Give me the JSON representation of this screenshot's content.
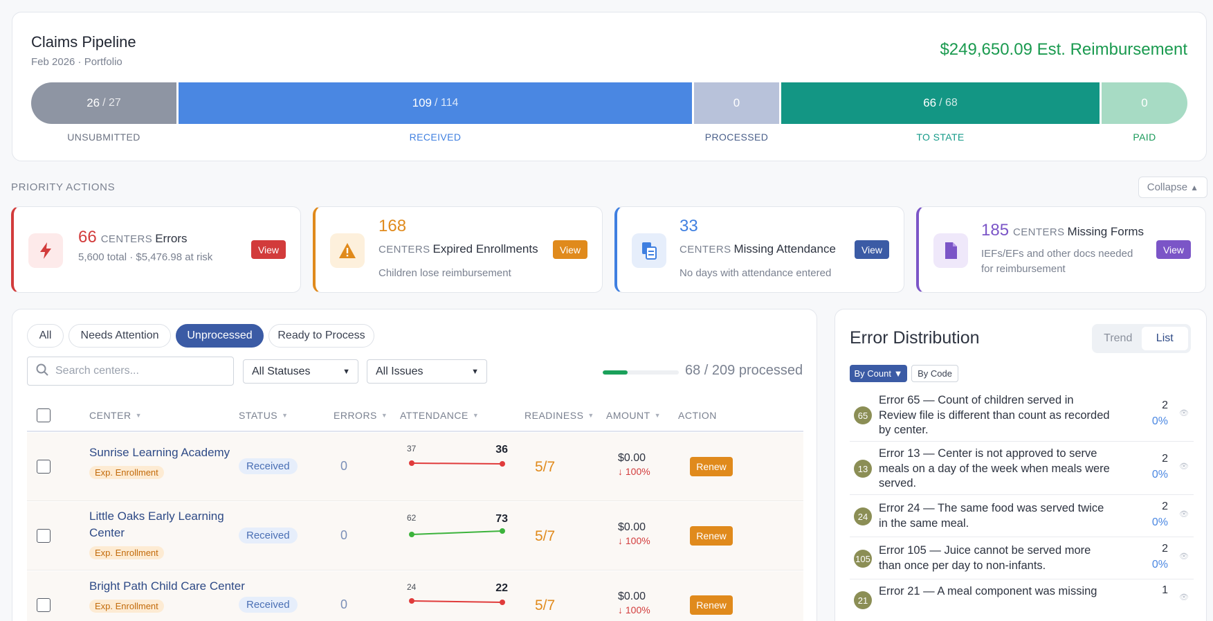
{
  "pipeline": {
    "title": "Claims Pipeline",
    "subtitle": "Feb 2026 · Portfolio",
    "est_amount": "$249,650.09 Est. Reimbursement",
    "segments": [
      {
        "value": "26",
        "total": "/ 27",
        "label": "UNSUBMITTED",
        "color": "#8e95a3",
        "label_color": "#6b7282"
      },
      {
        "value": "109",
        "total": "/ 114",
        "label": "RECEIVED",
        "color": "#4a87e2",
        "label_color": "#3f7fe0"
      },
      {
        "value": "0",
        "total": "",
        "label": "PROCESSED",
        "color": "#b8c2da",
        "label_color": "#4a5f8a"
      },
      {
        "value": "66",
        "total": "/ 68",
        "label": "TO STATE",
        "color": "#139684",
        "label_color": "#149a88"
      },
      {
        "value": "0",
        "total": "",
        "label": "PAID",
        "color": "#a7dbc4",
        "label_color": "#1a9a5a"
      }
    ]
  },
  "priority": {
    "title": "PRIORITY ACTIONS",
    "collapse_label": "Collapse",
    "cards": [
      {
        "num": "66",
        "kicker": "CENTERS",
        "main": "Errors",
        "sub": "5,600 total · $5,476.98 at risk",
        "view": "View",
        "icon": "lightning-icon"
      },
      {
        "num": "168",
        "kicker": "CENTERS",
        "main": "Expired Enrollments",
        "sub": "Children lose reimbursement",
        "view": "View",
        "icon": "warning-icon"
      },
      {
        "num": "33",
        "kicker": "CENTERS",
        "main": "Missing Attendance",
        "sub": "No days with attendance entered",
        "view": "View",
        "icon": "document-copy-icon"
      },
      {
        "num": "185",
        "kicker": "CENTERS",
        "main": "Missing Forms",
        "sub": "IEFs/EFs and other docs needed for reimbursement",
        "view": "View",
        "icon": "file-icon"
      }
    ],
    "colors": [
      "#d23b3b",
      "#e08a1c",
      "#3f7fe0",
      "#7b55c7"
    ]
  },
  "filters": {
    "tabs": [
      "All",
      "Needs Attention",
      "Unprocessed",
      "Ready to Process"
    ],
    "active_tab": "Unprocessed",
    "search_placeholder": "Search centers...",
    "status_select": "All Statuses",
    "issues_select": "All Issues",
    "progress_text": "68 / 209 processed",
    "progress_fraction": 0.325
  },
  "table": {
    "headers": {
      "center": "CENTER",
      "status": "STATUS",
      "errors": "ERRORS",
      "attendance": "ATTENDANCE",
      "readiness": "READINESS",
      "amount": "AMOUNT",
      "action": "ACTION"
    },
    "rows": [
      {
        "name": "Sunrise Learning Academy",
        "tag": "Exp. Enrollment",
        "status": "Received",
        "errors": "0",
        "att_prev": "37",
        "att_curr": "36",
        "trend": "down",
        "readiness": "5/7",
        "amount": "$0.00",
        "amount_change": "↓ 100%",
        "action": "Renew"
      },
      {
        "name": "Little Oaks Early Learning Center",
        "tag": "Exp. Enrollment",
        "status": "Received",
        "errors": "0",
        "att_prev": "62",
        "att_curr": "73",
        "trend": "up",
        "readiness": "5/7",
        "amount": "$0.00",
        "amount_change": "↓ 100%",
        "action": "Renew"
      },
      {
        "name": "Bright Path Child Care Center",
        "tag": "Exp. Enrollment",
        "status": "Received",
        "errors": "0",
        "att_prev": "24",
        "att_curr": "22",
        "trend": "down",
        "readiness": "5/7",
        "amount": "$0.00",
        "amount_change": "↓ 100%",
        "action": "Renew"
      }
    ]
  },
  "errors": {
    "title": "Error Distribution",
    "toggle": [
      "Trend",
      "List"
    ],
    "active_toggle": "List",
    "sort": [
      "By Count ▼",
      "By Code"
    ],
    "items": [
      {
        "code": "65",
        "text": "Error 65 — Count of children served in Review file is different than count as recorded by center.",
        "count": "2",
        "pct": "0%"
      },
      {
        "code": "13",
        "text": "Error 13 — Center is not approved to serve meals on a day of the week when meals were served.",
        "count": "2",
        "pct": "0%"
      },
      {
        "code": "24",
        "text": "Error 24 — The same food was served twice in the same meal.",
        "count": "2",
        "pct": "0%"
      },
      {
        "code": "105",
        "text": "Error 105 — Juice cannot be served more than once per day to non-infants.",
        "count": "2",
        "pct": "0%"
      },
      {
        "code": "21",
        "text": "Error 21 — A meal component was missing",
        "count": "1",
        "pct": ""
      }
    ]
  }
}
